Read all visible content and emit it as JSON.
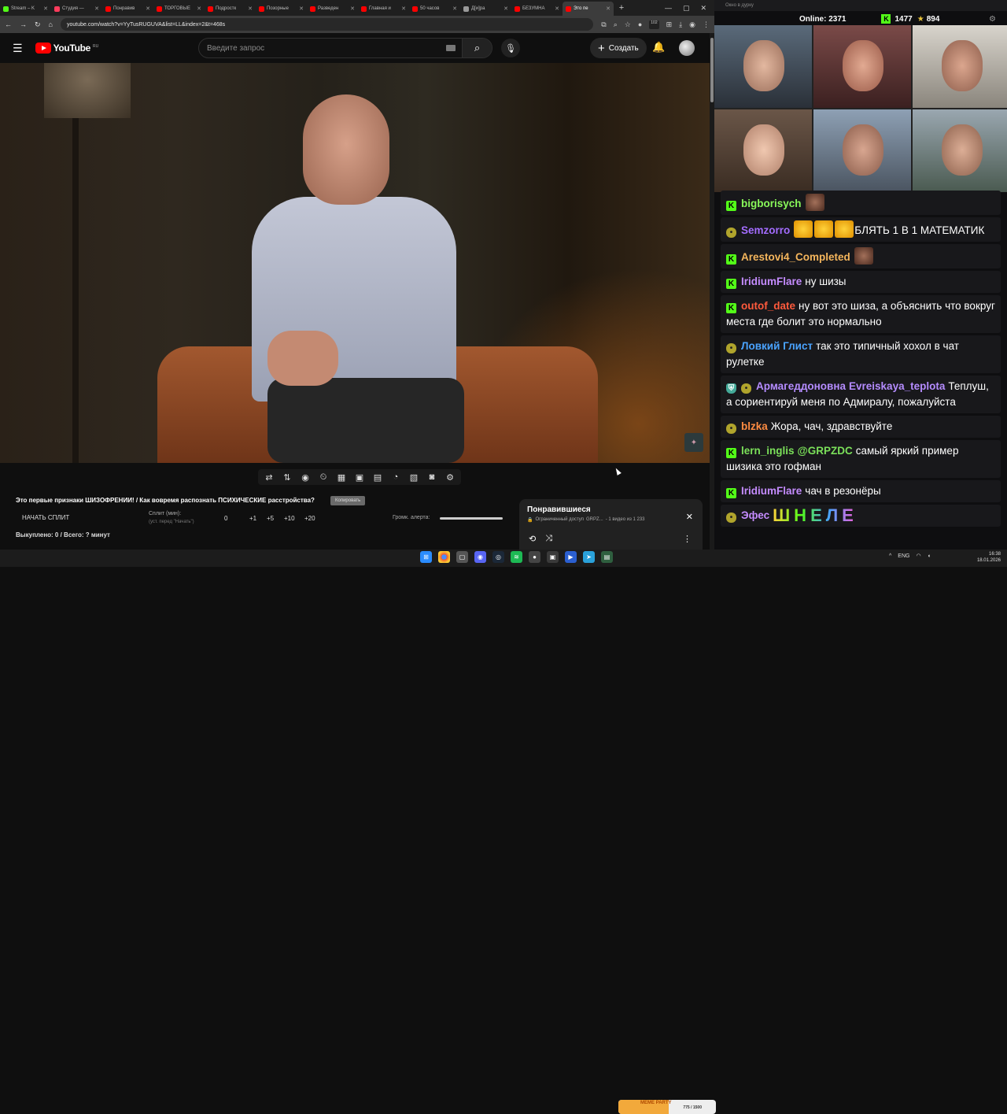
{
  "browser": {
    "tabs": [
      {
        "title": "Stream – K",
        "color": "#53fc18"
      },
      {
        "title": "Студия —",
        "color": "#ff3b5c"
      },
      {
        "title": "Понравив",
        "color": "#ff0000"
      },
      {
        "title": "ТОРГОВЫЕ",
        "color": "#ff0000"
      },
      {
        "title": "Подростк",
        "color": "#ff0000"
      },
      {
        "title": "Позорные",
        "color": "#ff0000"
      },
      {
        "title": "Разведен",
        "color": "#ff0000"
      },
      {
        "title": "Главная и",
        "color": "#ff0000"
      },
      {
        "title": "50 часов",
        "color": "#ff0000"
      },
      {
        "title": "Д[и]ра",
        "color": "#999999"
      },
      {
        "title": "БЕЗУМНА",
        "color": "#ff0000"
      },
      {
        "title": "Это пе",
        "color": "#ff0000",
        "active": true
      }
    ],
    "url": "youtube.com/watch?v=YyTusRUGUVA&list=LL&index=2&t=468s",
    "ext_badge": "102"
  },
  "youtube": {
    "logo_text": "YouTube",
    "region": "RU",
    "search_placeholder": "Введите запрос",
    "create_label": "Создать"
  },
  "player": {
    "toolbar_icons": [
      "loop-icon",
      "sort-icon",
      "audio-icon",
      "speed-icon",
      "clapper-icon",
      "crop-icon",
      "film-icon",
      "gauge-icon",
      "picture-icon",
      "camera-icon",
      "settings-icon"
    ]
  },
  "split": {
    "title": "Это первые признаки ШИЗОФРЕНИИ! / Как вовремя распознать ПСИХИЧЕСКИЕ расстройства?",
    "copy_label": "Копировать",
    "start_label": "НАЧАТЬ СПЛИТ",
    "split_label": "Сплит (мин):",
    "split_hint": "(уст. перед \"Начать\")",
    "split_value": "0",
    "increments": [
      "+1",
      "+5",
      "+10",
      "+20"
    ],
    "alert_label": "Громк. алерта:",
    "alert_volume": 1.0,
    "summary": "Выкуплено: 0 / Всего: ? минут"
  },
  "liked_panel": {
    "title": "Понравившиеся",
    "access": "Ограниченный доступ",
    "owner": "GRPZ...",
    "position": "- 1 видео из 1 233"
  },
  "side": {
    "window_title": "Окно в дурку",
    "online_label": "Online:",
    "online_count": "2371",
    "kick_count": "1477",
    "star_count": "894"
  },
  "chat": [
    {
      "user": "bigborisych",
      "color": "#89f85a",
      "badge": "kick",
      "text": "",
      "emotes": [
        "face"
      ]
    },
    {
      "user": "Semzorro",
      "color": "#a36cff",
      "badge": "pepe",
      "text": "БЛЯТЬ 1 В 1 МАТЕМАТИК",
      "emotes_before": [
        "laugh",
        "laugh",
        "laugh"
      ]
    },
    {
      "user": "Arestovi4_Completed",
      "color": "#f4b55c",
      "badge": "kick",
      "text": "",
      "emotes": [
        "face"
      ]
    },
    {
      "user": "IridiumFlare",
      "color": "#c58cff",
      "badge": "kick",
      "text": "ну шизы"
    },
    {
      "user": "outof_date",
      "color": "#ff5a3c",
      "badge": "kick",
      "text": "ну вот это шиза, а объяснить что вокруг места где болит это нормально"
    },
    {
      "user": "Ловкий Глист",
      "color": "#4aa3ff",
      "badge": "pepe",
      "text": "так это типичный хохол в чат рулетке"
    },
    {
      "user": "Армагеддоновна",
      "color": "#b58cff",
      "badge": "shield",
      "extra_badge": "pepe",
      "mention": "Evreiskaya_teplota",
      "mention_color": "#b58cff",
      "text": "Теплуш, а сориентируй меня по Адмиралу, пожалуйста"
    },
    {
      "user": "blzka",
      "color": "#ff8c42",
      "badge": "pepe",
      "text": "Жора, чач, здравствуйте"
    },
    {
      "user": "lern_inglis",
      "color": "#7be05a",
      "badge": "kick",
      "mention": "@GRPZDC",
      "mention_color": "#7be05a",
      "text": "самый яркий пример шизика это гофман"
    },
    {
      "user": "IridiumFlare",
      "color": "#c58cff",
      "badge": "kick",
      "text": "чач в резонёры"
    },
    {
      "user": "Эфес",
      "color": "#c58cff",
      "badge": "pepe",
      "text": "",
      "big_text": "ШНЕЛЕ"
    }
  ],
  "taskbar": {
    "meme_label": "MEME PARTY",
    "meme_count": "775 / 1500",
    "meme_progress": 0.52,
    "lang": "ENG",
    "time": "16:38",
    "date": "18.01.2026"
  }
}
